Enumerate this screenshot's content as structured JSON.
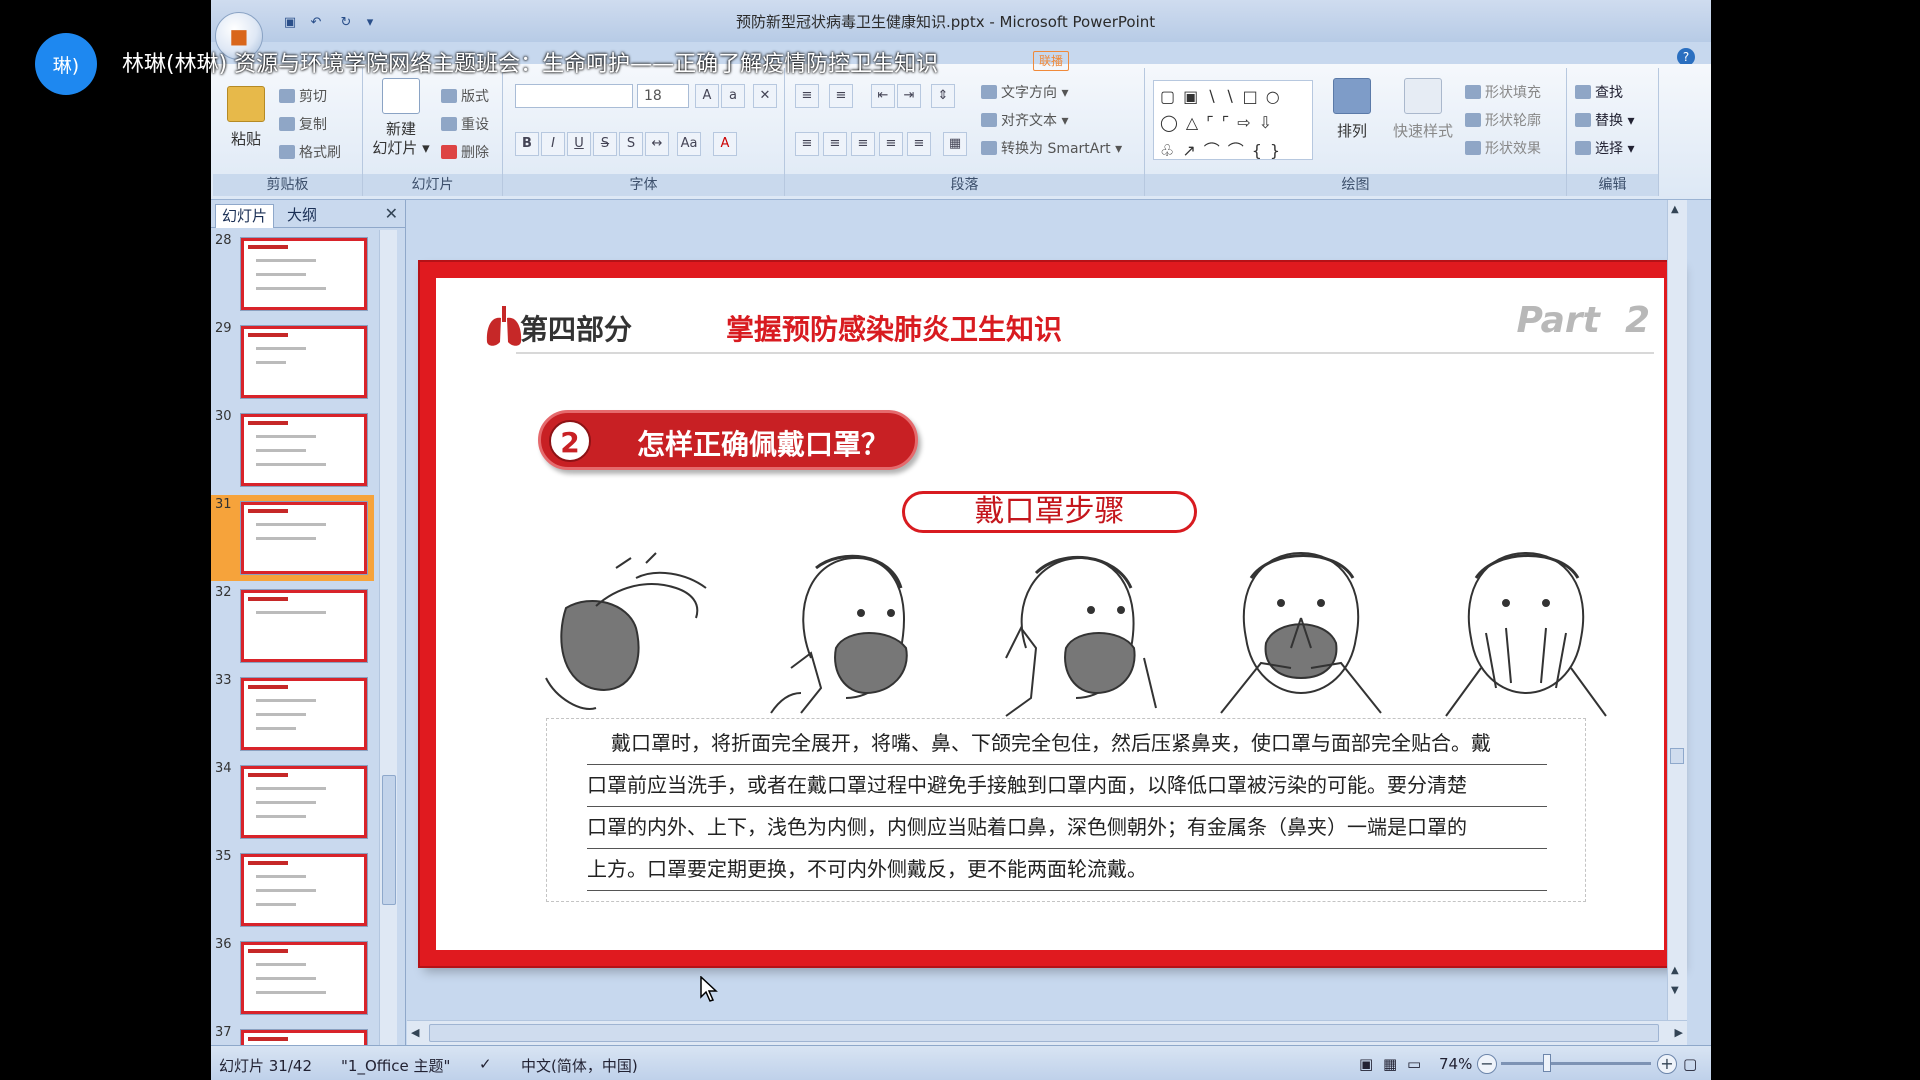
{
  "stream": {
    "avatar_text": "琳)",
    "title": "林琳(林琳) 资源与环境学院网络主题班会：生命呵护——正确了解疫情防控卫生知识",
    "badge": "联播"
  },
  "window": {
    "title": "预防新型冠状病毒卫生健康知识.pptx - Microsoft PowerPoint"
  },
  "ribbon": {
    "clipboard": {
      "label": "剪贴板",
      "paste": "粘贴",
      "cut": "剪切",
      "copy": "复制",
      "format_painter": "格式刷"
    },
    "slides": {
      "label": "幻灯片",
      "new_slide_1": "新建",
      "new_slide_2": "幻灯片",
      "layout": "版式",
      "reset": "重设",
      "delete": "删除"
    },
    "font": {
      "label": "字体",
      "font_size": "18"
    },
    "paragraph": {
      "label": "段落",
      "text_direction": "文字方向",
      "align_text": "对齐文本",
      "smartart": "转换为 SmartArt"
    },
    "drawing": {
      "label": "绘图",
      "arrange": "排列",
      "quick_styles": "快速样式",
      "shape_fill": "形状填充",
      "shape_outline": "形状轮廓",
      "shape_effects": "形状效果"
    },
    "editing": {
      "label": "编辑",
      "find": "查找",
      "replace": "替换",
      "select": "选择"
    }
  },
  "pane": {
    "tab_slides": "幻灯片",
    "tab_outline": "大纲",
    "thumbnails": [
      "28",
      "29",
      "30",
      "31",
      "32",
      "33",
      "34",
      "35",
      "36",
      "37"
    ],
    "selected": "31"
  },
  "slide": {
    "section_label": "第四部分",
    "section_title": "掌握预防感染肺炎卫生知识",
    "part_label": "Part  2",
    "question_number": "2",
    "question_text": "怎样正确佩戴口罩？",
    "steps_label": "戴口罩步骤",
    "paragraph_lines": [
      "戴口罩时，将折面完全展开，将嘴、鼻、下颌完全包住，然后压紧鼻夹，使口罩与面部完全贴合。戴",
      "口罩前应当洗手，或者在戴口罩过程中避免手接触到口罩内面，以降低口罩被污染的可能。要分清楚",
      "口罩的内外、上下，浅色为内侧，内侧应当贴着口鼻，深色侧朝外；有金属条（鼻夹）一端是口罩的",
      "上方。口罩要定期更换，不可内外侧戴反，更不能两面轮流戴。"
    ]
  },
  "status": {
    "slide_info": "幻灯片 31/42",
    "theme": "\"1_Office 主题\"",
    "language": "中文(简体，中国)",
    "zoom": "74%"
  },
  "colors": {
    "accent_red": "#d81b20",
    "ribbon_blue": "#c9d9ed",
    "thumb_selected": "#f6a33b"
  }
}
